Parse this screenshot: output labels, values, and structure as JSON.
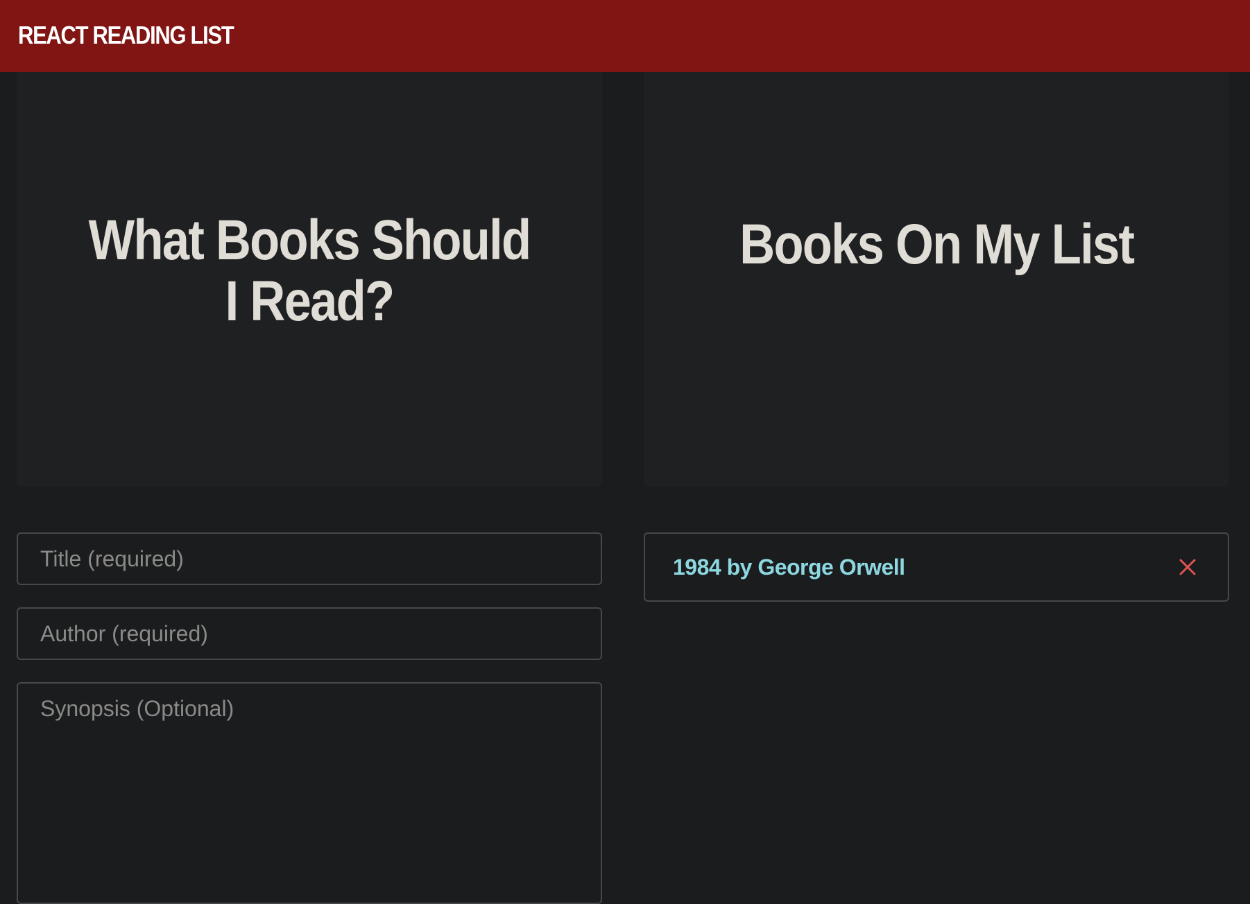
{
  "header": {
    "brand": "REACT READING LIST",
    "background_color": "#801513"
  },
  "form_panel": {
    "heading": "What Books Should I Read?",
    "title_placeholder": "Title (required)",
    "author_placeholder": "Author (required)",
    "synopsis_placeholder": "Synopsis (Optional)"
  },
  "list_panel": {
    "heading": "Books On My List",
    "books": [
      {
        "label": "1984 by George Orwell",
        "remove_icon": "close-icon",
        "text_color": "#8dd7e0",
        "icon_color": "#e05452"
      }
    ]
  }
}
